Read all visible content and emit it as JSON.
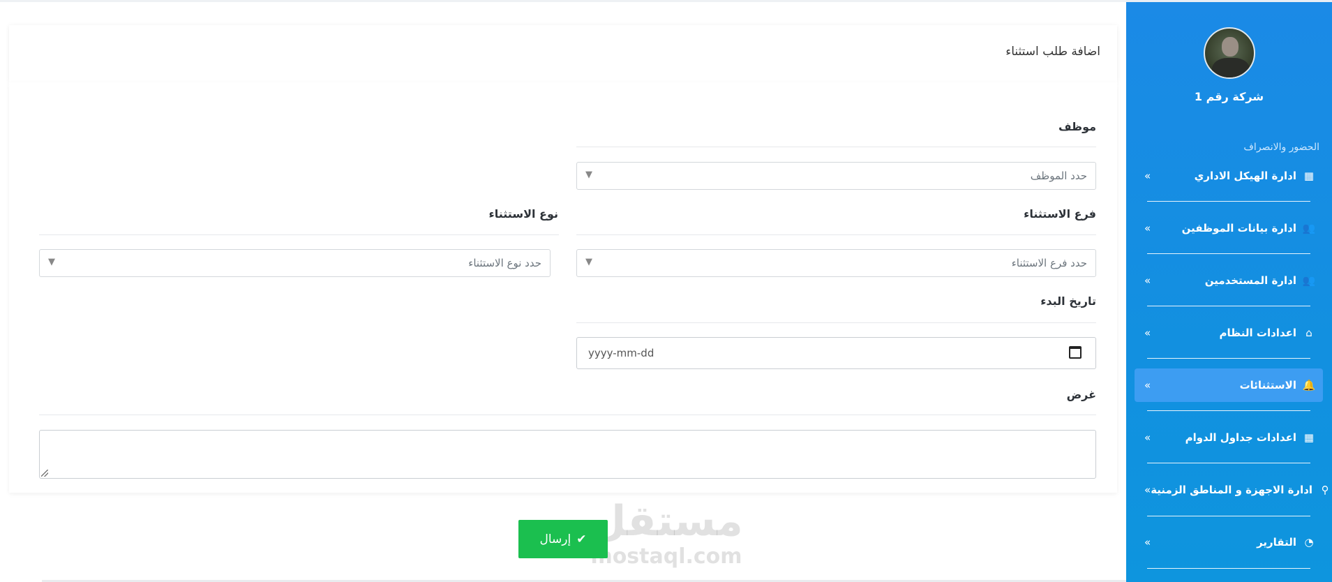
{
  "sidebar": {
    "company_name": "شركة رقم 1",
    "section_label": "الحضور والانصراف",
    "items": [
      {
        "label": "ادارة الهيكل الاداري",
        "icon": "bar-chart-icon",
        "glyph": "▦"
      },
      {
        "label": "ادارة بيانات الموظفين",
        "icon": "users-icon",
        "glyph": "👥"
      },
      {
        "label": "ادارة المستخدمين",
        "icon": "users-icon",
        "glyph": "👥"
      },
      {
        "label": "اعدادات النظام",
        "icon": "home-icon",
        "glyph": "⌂"
      },
      {
        "label": "الاستثنائات",
        "icon": "bell-icon",
        "glyph": "🔔",
        "active": true
      },
      {
        "label": "اعدادات جداول الدوام",
        "icon": "calendar-icon",
        "glyph": "▦"
      },
      {
        "label": "ادارة الاجهزة و المناطق الزمنية",
        "icon": "map-marker-icon",
        "glyph": "⚲"
      },
      {
        "label": "التقارير",
        "icon": "dashboard-icon",
        "glyph": "◔"
      }
    ],
    "chevron_glyph": "«"
  },
  "page": {
    "title": "اضافة طلب استثناء"
  },
  "form": {
    "employee_label": "موظف",
    "employee_placeholder": "حدد الموظف",
    "branch_label": "فرع الاستثناء",
    "branch_placeholder": "حدد فرع الاستثناء",
    "type_label": "نوع الاستثناء",
    "type_placeholder": "حدد نوع الاستثناء",
    "start_date_label": "تاريخ البدء",
    "start_date_value": "yyyy-mm-dd",
    "purpose_label": "غرض",
    "purpose_value": "",
    "arrow_glyph": "▼"
  },
  "submit": {
    "label": "إرسال",
    "icon_glyph": "✔"
  },
  "watermark": {
    "arabic": "مستقل",
    "latin": "mostaql.com"
  },
  "colors": {
    "sidebar": "#1b8ae6",
    "active_item": "#3d9df2",
    "submit": "#1bbf4f"
  }
}
